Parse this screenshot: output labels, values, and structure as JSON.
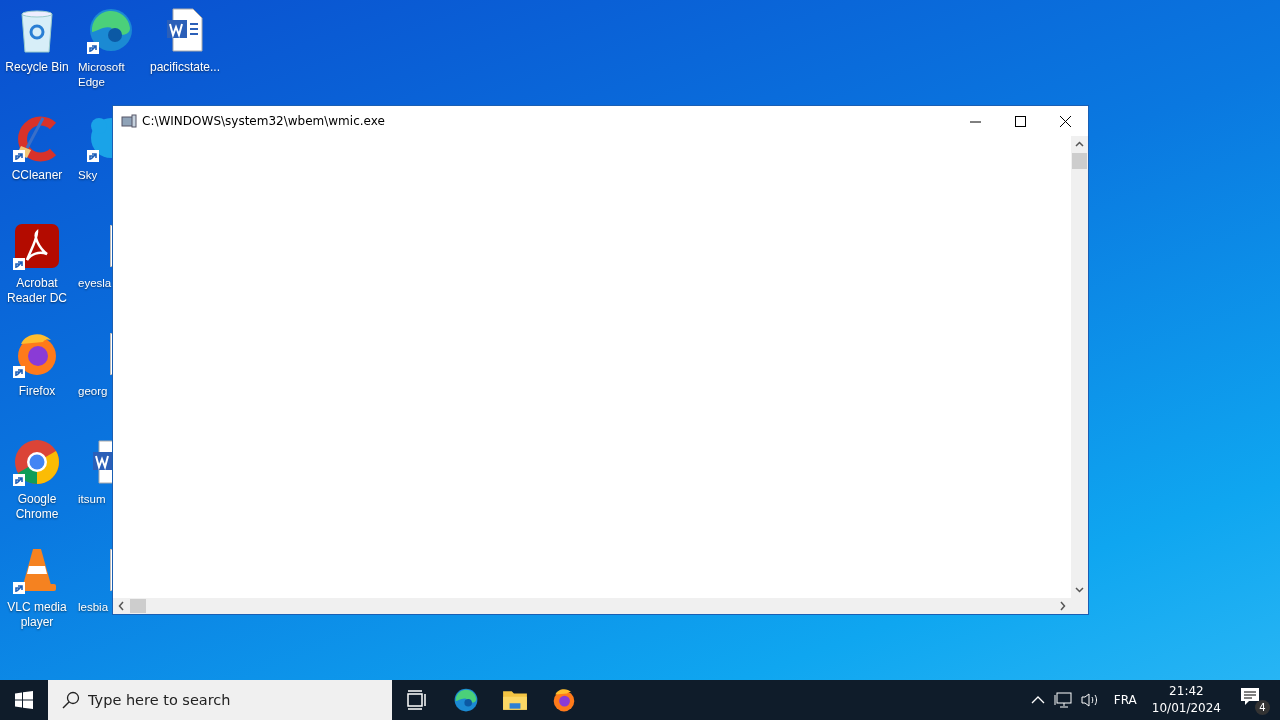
{
  "desktop_columns": [
    [
      {
        "label": "Recycle Bin",
        "kind": "recycle",
        "shortcut": false
      },
      {
        "label": "CCleaner",
        "kind": "ccleaner",
        "shortcut": true
      },
      {
        "label": "Acrobat Reader DC",
        "kind": "acrobat",
        "shortcut": true
      },
      {
        "label": "Firefox",
        "kind": "firefox",
        "shortcut": true
      },
      {
        "label": "Google Chrome",
        "kind": "chrome",
        "shortcut": true
      },
      {
        "label": "VLC media player",
        "kind": "vlc",
        "shortcut": true
      }
    ],
    [
      {
        "label": "Microsoft Edge",
        "kind": "edge",
        "shortcut": true
      },
      {
        "label": "Sky",
        "kind": "skype",
        "shortcut": true
      },
      {
        "label": "eyesla",
        "kind": "image",
        "shortcut": false
      },
      {
        "label": "georg",
        "kind": "image",
        "shortcut": false
      },
      {
        "label": "itsum",
        "kind": "word",
        "shortcut": false
      },
      {
        "label": "lesbia",
        "kind": "image",
        "shortcut": false
      }
    ],
    [
      {
        "label": "pacificstate...",
        "kind": "word",
        "shortcut": false
      }
    ]
  ],
  "window": {
    "title": "C:\\WINDOWS\\system32\\wbem\\wmic.exe"
  },
  "taskbar": {
    "search": {
      "placeholder": "Type here to search"
    },
    "apps": [
      {
        "kind": "taskview"
      },
      {
        "kind": "edge"
      },
      {
        "kind": "folder"
      },
      {
        "kind": "firefox"
      }
    ],
    "tray": {
      "language": "FRA",
      "time": "21:42",
      "date": "10/01/2024",
      "notifications": "4"
    }
  }
}
